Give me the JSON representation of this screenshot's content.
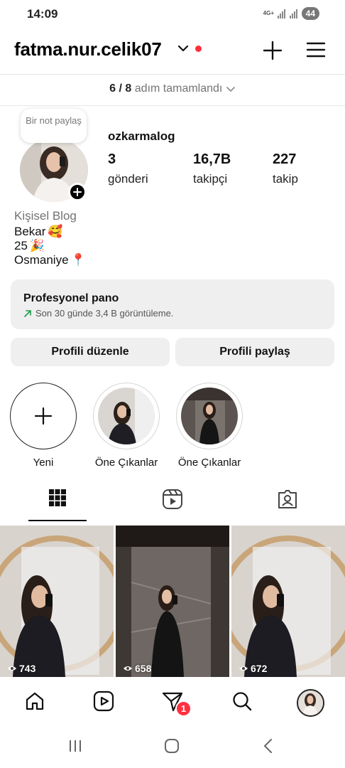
{
  "status_bar": {
    "time": "14:09",
    "network": "4G+",
    "battery": "44"
  },
  "header": {
    "username": "fatma.nur.celik07"
  },
  "progress": {
    "count": "6 / 8",
    "label": "adım tamamlandı"
  },
  "note_bubble": "Bir not paylaş",
  "profile": {
    "name": "ozkarmalog",
    "stats": [
      {
        "value": "3",
        "label": "gönderi"
      },
      {
        "value": "16,7B",
        "label": "takipçi"
      },
      {
        "value": "227",
        "label": "takip"
      }
    ],
    "bio": {
      "category": "Kişisel Blog",
      "lines": [
        {
          "text": "Bekar",
          "emoji": "🥰"
        },
        {
          "text": "25",
          "emoji": "🎉"
        },
        {
          "text": "Osmaniye",
          "emoji": "📍"
        }
      ]
    }
  },
  "pro_dashboard": {
    "title": "Profesyonel pano",
    "subtitle": "Son 30 günde 3,4 B görüntüleme."
  },
  "buttons": {
    "edit": "Profili düzenle",
    "share": "Profili paylaş"
  },
  "highlights": [
    {
      "label": "Yeni"
    },
    {
      "label": "Öne Çıkanlar"
    },
    {
      "label": "Öne Çıkanlar"
    }
  ],
  "tabs": [
    {
      "icon": "grid-icon",
      "active": true
    },
    {
      "icon": "reels-icon",
      "active": false
    },
    {
      "icon": "tagged-icon",
      "active": false
    }
  ],
  "posts": [
    {
      "views": "743"
    },
    {
      "views": "658"
    },
    {
      "views": "672"
    }
  ],
  "bottom_nav": {
    "items": [
      "home-icon",
      "reels-icon",
      "direct-message-icon",
      "search-icon",
      "profile-avatar"
    ],
    "message_badge": "1"
  },
  "colors": {
    "accent_red": "#ff3040",
    "panel_gray": "#efefef",
    "muted_text": "#737373",
    "trend_green": "#1a9a4b"
  }
}
